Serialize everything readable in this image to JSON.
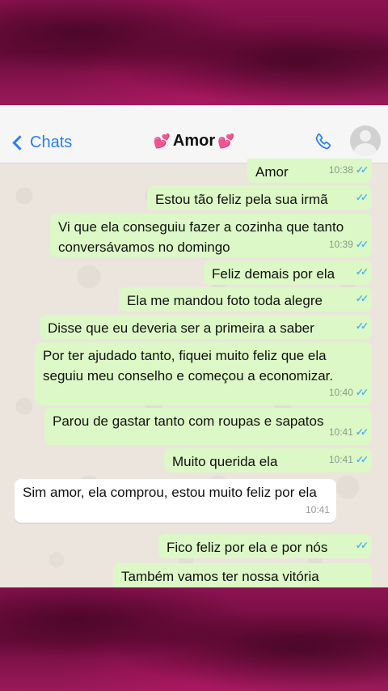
{
  "header": {
    "back_label": "Chats",
    "contact_name": "Amor",
    "heart_glyph": "💕"
  },
  "messages": [
    {
      "dir": "out",
      "text": "Amor",
      "time": "10:38"
    },
    {
      "dir": "out",
      "text": "Estou tão feliz pela sua irmã",
      "time": ""
    },
    {
      "dir": "out",
      "text": "Vi que ela conseguiu fazer a cozinha que tanto conversávamos no domingo",
      "time": "10:39"
    },
    {
      "dir": "out",
      "text": "Feliz demais por ela",
      "time": ""
    },
    {
      "dir": "out",
      "text": "Ela me mandou foto toda alegre",
      "time": ""
    },
    {
      "dir": "out",
      "text": "Disse que eu deveria ser a primeira a saber",
      "time": ""
    },
    {
      "dir": "out",
      "text": "Por ter ajudado tanto, fiquei muito feliz que ela seguiu meu conselho e começou a economizar.",
      "time": "10:40"
    },
    {
      "dir": "out",
      "text": "Parou de gastar tanto com roupas e sapatos",
      "time": "10:41"
    },
    {
      "dir": "out",
      "text": "Muito querida ela",
      "time": "10:41"
    },
    {
      "dir": "in",
      "text": "Sim amor, ela comprou, estou muito feliz por ela",
      "time": "10:41"
    },
    {
      "dir": "out",
      "text": "Fico feliz por ela e por nós",
      "time": ""
    },
    {
      "dir": "out",
      "text": "Também vamos ter nossa vitória",
      "time": ""
    }
  ],
  "colors": {
    "accent": "#2b7ef6",
    "outgoing_bubble": "#dcf8c6",
    "incoming_bubble": "#ffffff",
    "read_ticks": "#4fb6ec",
    "frame": "#7a0f45"
  }
}
